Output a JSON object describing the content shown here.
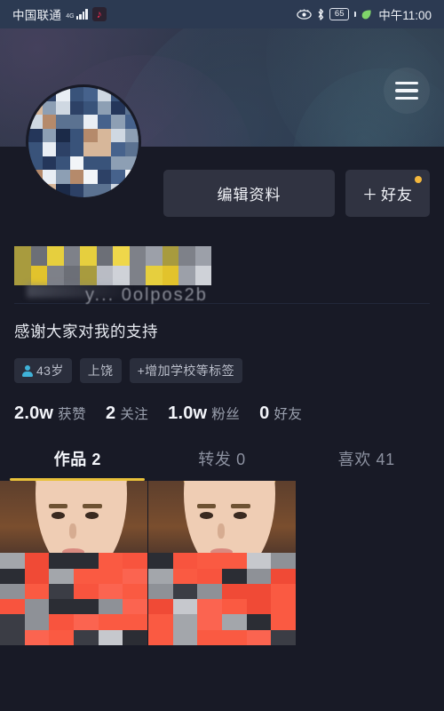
{
  "statusbar": {
    "carrier": "中国联通",
    "network": "4G",
    "app_icon": "douyin-icon",
    "eye_icon": "eye-protection-icon",
    "bluetooth_icon": "bluetooth-icon",
    "battery_level": "65",
    "leaf_icon": "power-saving-leaf-icon",
    "clock": "中午11:00"
  },
  "header": {
    "menu_icon": "hamburger-menu-icon"
  },
  "profile": {
    "avatar_alt": "user-avatar-pixelated",
    "edit_button": "编辑资料",
    "friend_button": "好友",
    "friend_button_plus": "＋",
    "friend_badge": "new-indicator-dot",
    "username_redacted": "y... 0olpos2b",
    "bio": "感谢大家对我的支持",
    "tags": [
      {
        "name": "age-tag",
        "icon": "person-icon",
        "label": "43岁"
      },
      {
        "name": "location-tag",
        "icon": "",
        "label": "上饶"
      },
      {
        "name": "add-school-tag",
        "icon": "",
        "label": "+增加学校等标签"
      }
    ]
  },
  "stats": [
    {
      "name": "likes-stat",
      "value": "2.0w",
      "label": "获赞"
    },
    {
      "name": "following-stat",
      "value": "2",
      "label": "关注"
    },
    {
      "name": "fans-stat",
      "value": "1.0w",
      "label": "粉丝"
    },
    {
      "name": "friends-stat",
      "value": "0",
      "label": "好友"
    }
  ],
  "tabs": [
    {
      "name": "tab-works",
      "label": "作品 2",
      "active": true
    },
    {
      "name": "tab-reposts",
      "label": "转发 0",
      "active": false
    },
    {
      "name": "tab-likes",
      "label": "喜欢 41",
      "active": false
    }
  ],
  "grid": {
    "items": [
      {
        "name": "video-thumbnail-1",
        "caption": ""
      },
      {
        "name": "video-thumbnail-2",
        "caption": ""
      }
    ]
  },
  "colors": {
    "page_bg": "#181a26",
    "statusbar_bg": "#2c3a52",
    "banner_top": "#30394f",
    "button_bg": "#303341",
    "accent_yellow": "#e8c13a",
    "badge_dot": "#f3b73d",
    "person_icon": "#3fb2d8",
    "overlay_red": "#fa5a42",
    "tag_bg": "#2a2e3c"
  }
}
